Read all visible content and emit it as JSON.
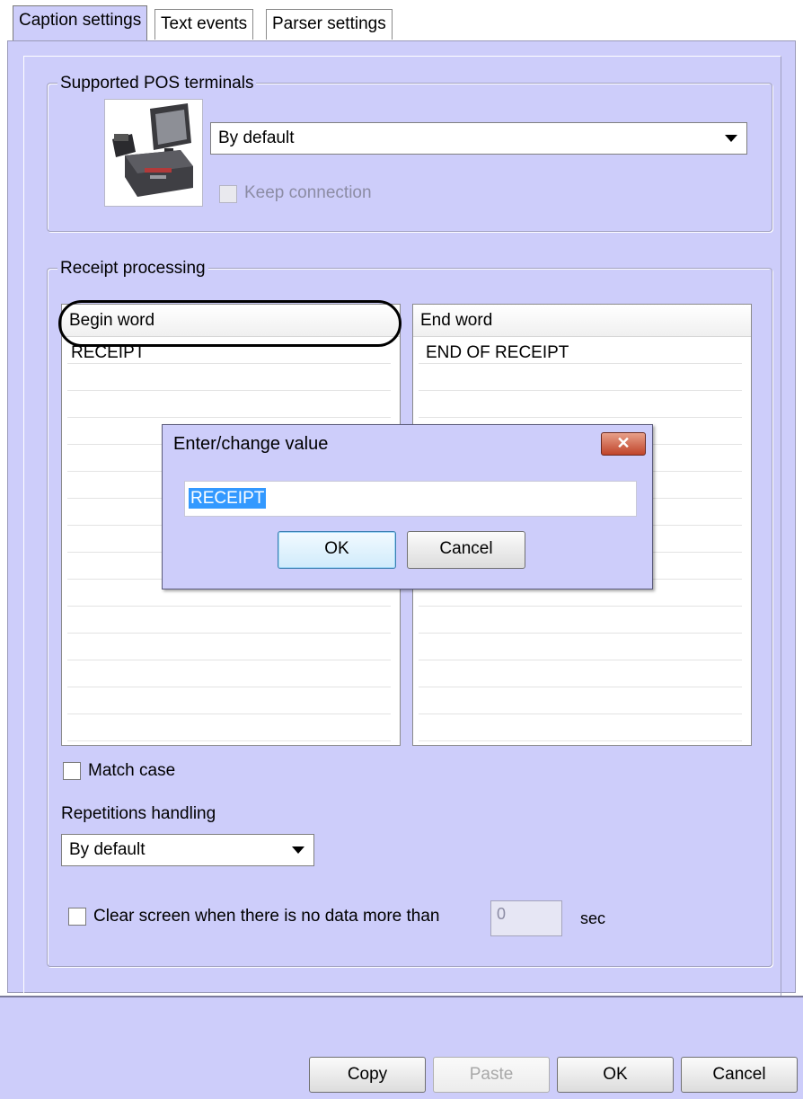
{
  "tabs": [
    {
      "label": "Caption settings",
      "active": true
    },
    {
      "label": "Text events",
      "active": false
    },
    {
      "label": "Parser settings",
      "active": false
    }
  ],
  "pos_group": {
    "legend": "Supported POS terminals",
    "terminal_select": "By default",
    "keep_connection_label": "Keep connection",
    "keep_connection_checked": false,
    "keep_connection_enabled": false
  },
  "receipt_group": {
    "legend": "Receipt processing",
    "begin_header": "Begin word",
    "begin_value": "RECEIPT",
    "end_header": "End word",
    "end_value": "END OF RECEIPT",
    "match_case_label": "Match case",
    "match_case_checked": false,
    "repetitions_label": "Repetitions handling",
    "repetitions_select": "By default",
    "clear_screen_label": "Clear screen when there is no data more than",
    "clear_screen_checked": false,
    "clear_screen_value": "0",
    "clear_screen_unit": "sec"
  },
  "dialog": {
    "title": "Enter/change value",
    "close_glyph": "✕",
    "input_value": "RECEIPT",
    "ok_label": "OK",
    "cancel_label": "Cancel"
  },
  "footer": {
    "copy_label": "Copy",
    "paste_label": "Paste",
    "ok_label": "OK",
    "cancel_label": "Cancel"
  },
  "colors": {
    "panel_bg": "#cdcdfa",
    "selection": "#3399ff",
    "close_button": "#c0442a"
  }
}
